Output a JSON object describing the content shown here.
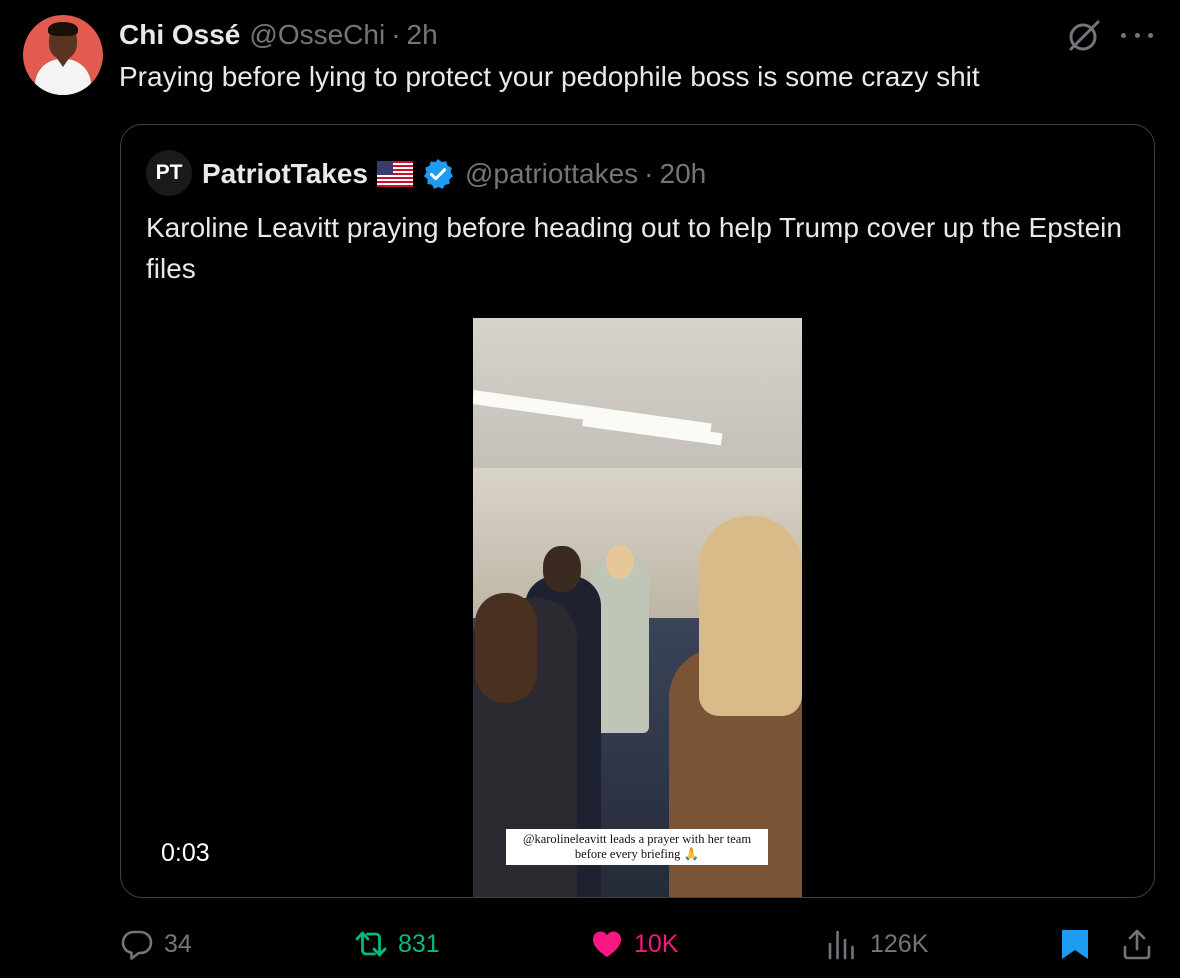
{
  "tweet": {
    "author_name": "Chi Ossé",
    "author_handle": "@OsseChi",
    "separator": "·",
    "time": "2h",
    "text": "Praying before lying to protect your pedophile boss is some crazy shit"
  },
  "quote": {
    "avatar_text": "PT",
    "author_name": "PatriotTakes",
    "author_handle": "@patriottakes",
    "separator": "·",
    "time": "20h",
    "text": "Karoline Leavitt praying before heading out to help Trump cover up the Epstein files",
    "video_caption_line1": "@karolineleavitt leads a prayer with her team",
    "video_caption_line2": "before every briefing 🙏",
    "video_time": "0:03"
  },
  "actions": {
    "replies": "34",
    "retweets": "831",
    "likes": "10K",
    "views": "126K"
  },
  "colors": {
    "background": "#000000",
    "text": "#e7e9ea",
    "muted": "#71767b",
    "retweet": "#00ba7c",
    "like": "#f91880",
    "verified": "#1d9bf0",
    "bookmark": "#1d9bf0"
  },
  "icons": [
    "grok-icon",
    "more-icon",
    "flag-icon",
    "verified-icon",
    "reply-icon",
    "retweet-icon",
    "like-icon",
    "views-icon",
    "bookmark-icon",
    "share-icon"
  ]
}
